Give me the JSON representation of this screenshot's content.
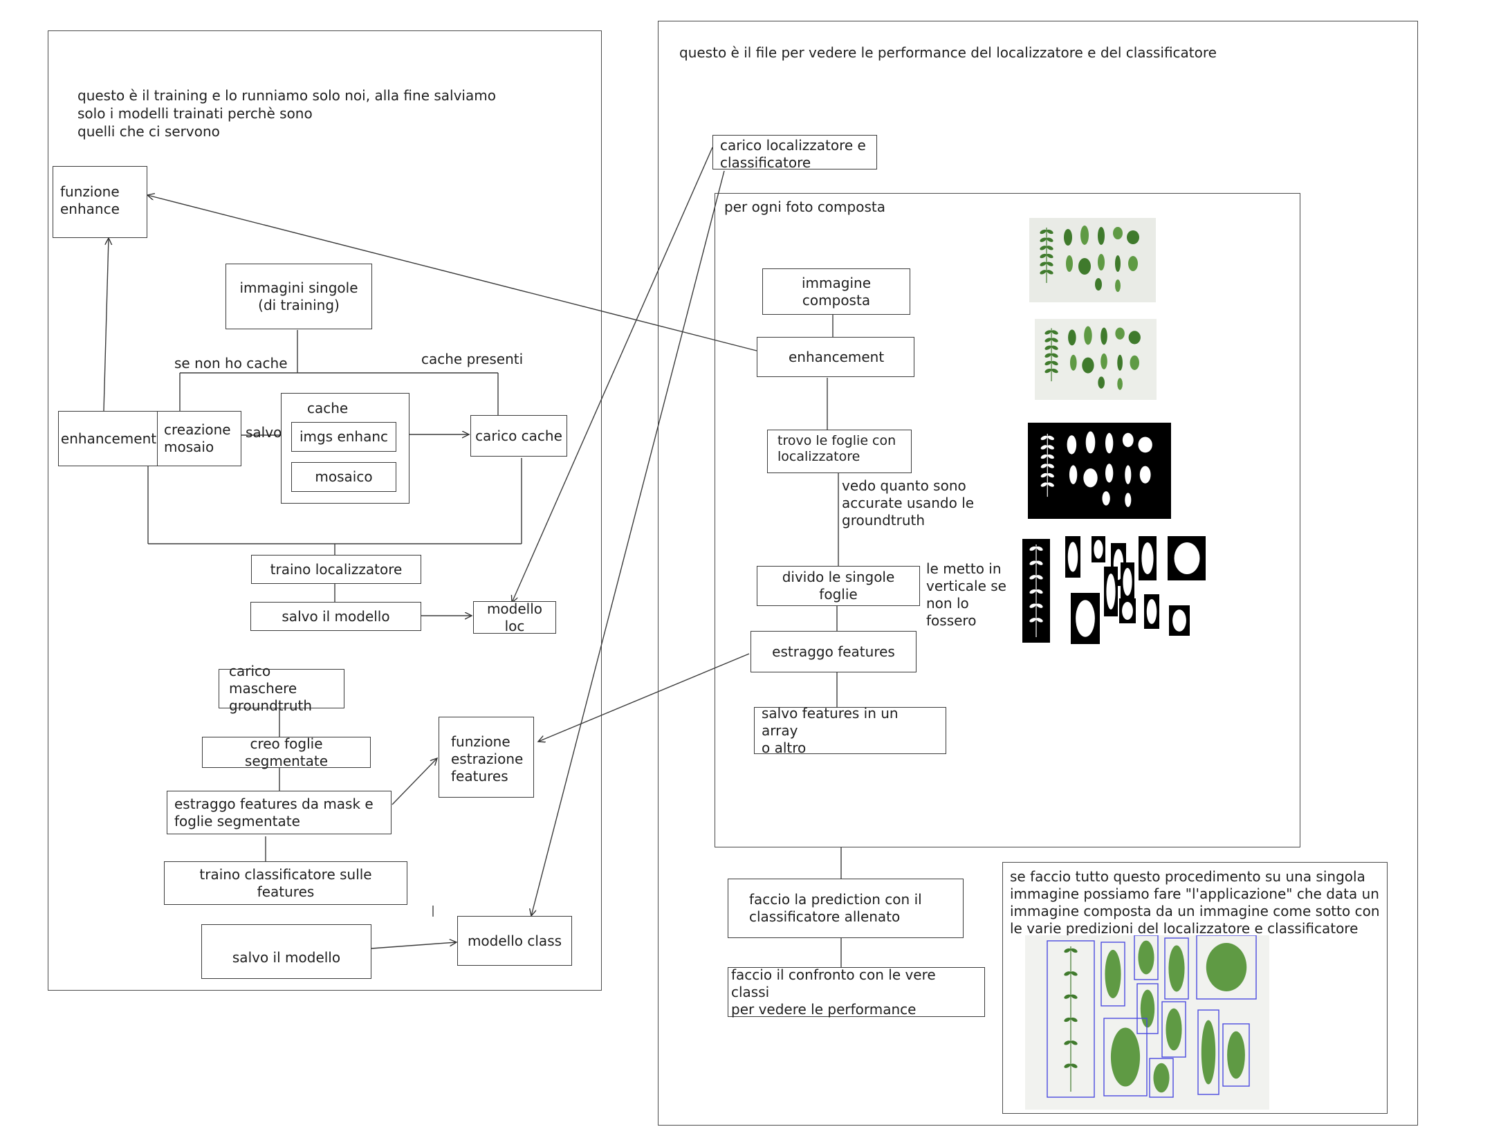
{
  "left_panel": {
    "note": "questo è il training e lo runniamo solo noi, alla fine salviamo\nsolo i modelli trainati perchè sono\nquelli che ci servono",
    "funzione_enhance": "funzione\nenhance",
    "immagini_singole": "immagini singole\n(di training)",
    "se_non_ho_cache": "se non ho cache",
    "cache_presenti": "cache presenti",
    "enhancement": "enhancement",
    "creazione_mosaio": "creazione\nmosaio",
    "salvo": "salvo",
    "cache": "cache",
    "imgs_enhanc": "imgs enhanc",
    "mosaico": "mosaico",
    "carico_cache": "carico cache",
    "traino_localizzatore": "traino localizzatore",
    "salvo_il_modello_loc": "salvo il modello",
    "modello_loc": "modello loc",
    "carico_maschere": "carico maschere\ngroundtruth",
    "creo_foglie": "creo foglie segmentate",
    "funzione_estrazione": "funzione\nestrazione\nfeatures",
    "estraggo_features_mask": "estraggo features da mask e\nfoglie segmentate",
    "traino_classificatore": "traino classificatore sulle features",
    "salvo_il_modello_class": "salvo il modello",
    "modello_class": "modello class"
  },
  "right_panel": {
    "note": "questo è il file per vedere le performance del localizzatore e del classificatore",
    "carico_loc_class": "carico localizzatore e\nclassificatore",
    "per_ogni_foto": "per ogni foto composta",
    "immagine_composta": "immagine composta",
    "enhancement": "enhancement",
    "trovo_foglie": "trovo le foglie con\nlocalizzatore",
    "vedo_quanto": "vedo quanto sono\naccurate usando le\ngroundtruth",
    "divido": "divido le singole foglie",
    "le_metto": "le metto in\nverticale se\nnon lo\nfossero",
    "estraggo_features": "estraggo features",
    "salvo_features": "salvo features in un array\no altro",
    "faccio_prediction": "faccio la prediction con il\nclassificatore allenato",
    "faccio_confronto": "faccio il confronto con le vere classi\nper vedere le performance",
    "app_note": "se faccio tutto questo procedimento su una singola\nimmagine possiamo fare \"l'applicazione\" che data un\nimmagine composta da un immagine come sotto con\nle varie predizioni del localizzatore e classificatore"
  },
  "colors": {
    "ink": "#1e1e1e",
    "leaf": "#5f9a44",
    "leaf_dark": "#3f7a2c",
    "photo_bg": "#e9ebe6",
    "mask_bg": "#000000",
    "bbox": "#4a4ae0"
  }
}
